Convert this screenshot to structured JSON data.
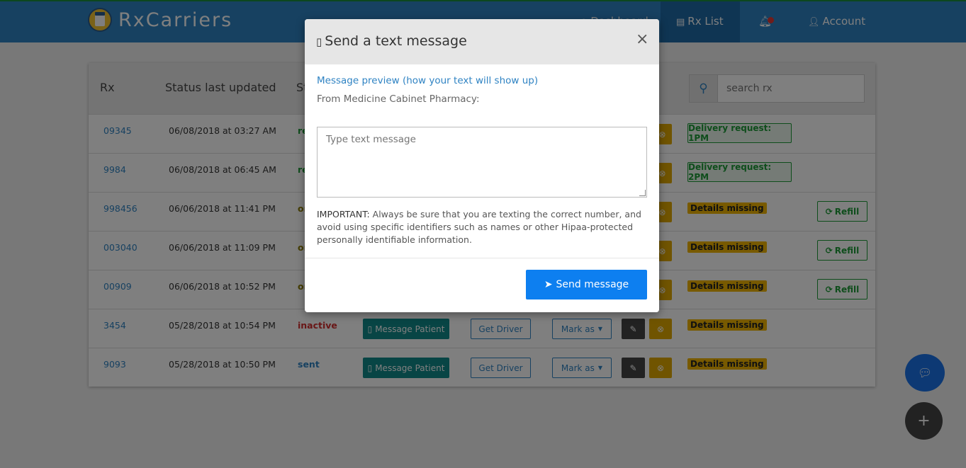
{
  "brand": {
    "name": "RxCarriers"
  },
  "nav": {
    "dashboard": "Dashboard",
    "rx_list": "Rx List",
    "account": "Account"
  },
  "table": {
    "headers": {
      "rx": "Rx",
      "updated": "Status last updated",
      "status": "St"
    },
    "search_placeholder": "search rx",
    "rows": [
      {
        "rx": "09345",
        "date": "06/08/2018 at 03:27 AM",
        "status": "re",
        "status_color": "green",
        "badge": "Delivery request: 1PM",
        "badge_type": "delivery",
        "refill": ""
      },
      {
        "rx": "9984",
        "date": "06/08/2018 at 06:45 AM",
        "status": "re",
        "status_color": "green",
        "badge": "Delivery request: 2PM",
        "badge_type": "delivery",
        "refill": ""
      },
      {
        "rx": "998456",
        "date": "06/06/2018 at 11:41 PM",
        "status": "or",
        "status_color": "olive",
        "badge": "Details missing",
        "badge_type": "missing",
        "refill": "Refill"
      },
      {
        "rx": "003040",
        "date": "06/06/2018 at 11:09 PM",
        "status": "or",
        "status_color": "olive",
        "badge": "Details missing",
        "badge_type": "missing",
        "refill": "Refill"
      },
      {
        "rx": "00909",
        "date": "06/06/2018 at 10:52 PM",
        "status": "or",
        "status_color": "olive",
        "badge": "Details missing",
        "badge_type": "missing",
        "refill": "Refill"
      },
      {
        "rx": "3454",
        "date": "05/28/2018 at 10:54 PM",
        "status": "inactive",
        "status_color": "red",
        "badge": "Details missing",
        "badge_type": "missing",
        "refill": "",
        "msg": "Message Patient",
        "driver": "Get Driver",
        "mark": "Mark as"
      },
      {
        "rx": "9093",
        "date": "05/28/2018 at 10:50 PM",
        "status": "sent",
        "status_color": "blue",
        "badge": "Details missing",
        "badge_type": "missing",
        "refill": "",
        "msg": "Message Patient",
        "driver": "Get Driver",
        "mark": "Mark as"
      }
    ]
  },
  "modal": {
    "title": "Send a text message",
    "close_symbol": "×",
    "preview_label": "Message preview (how your text will show up)",
    "from_text": "From Medicine Cabinet Pharmacy:",
    "textarea_placeholder": "Type text message",
    "important_label": "IMPORTANT:",
    "important_text": "Always be sure that you are texting the correct number, and avoid using specific identifiers such as names or other Hipaa-protected personally identifiable information.",
    "send_label": "Send message"
  },
  "icons": {
    "dashboard": "dashboard-icon",
    "rx_list": "list-icon",
    "bell": "bell-icon",
    "account": "user-icon",
    "search": "search-icon",
    "phone": "phone-icon",
    "send": "paper-plane-icon",
    "chat": "chat-icon",
    "add": "plus-icon",
    "edit": "pencil-icon",
    "delete": "close-circle-icon",
    "refill": "refresh-icon"
  },
  "colors": {
    "navbar": "#2f83c3",
    "primary": "#0d7ff0",
    "teal": "#118a8a",
    "warning": "#f0b400",
    "success": "#1d9b37"
  }
}
